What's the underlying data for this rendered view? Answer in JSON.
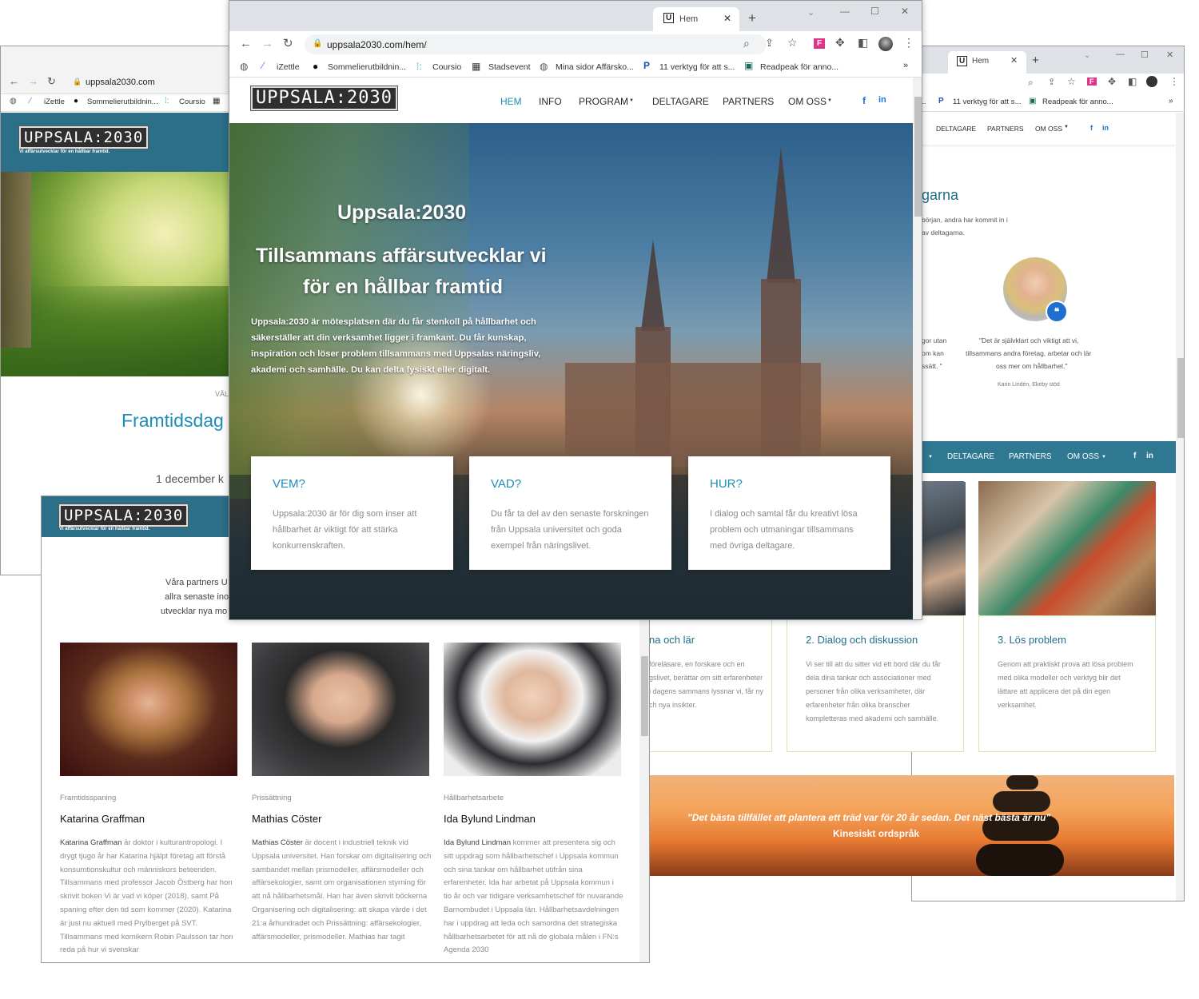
{
  "left_window": {
    "url": "uppsala2030.com",
    "bookmarks": [
      "iZettle",
      "Sommelierutbildnin...",
      "Coursio"
    ],
    "logo": "UPPSALA:2030",
    "tagline": "Vi affärsutvecklar för en hållbar framtid.",
    "eyebrow": "VÄL",
    "heading": "Framtidsdag",
    "date": "1 december k"
  },
  "right_window": {
    "tab_title": "Hem",
    "bookmarks": [
      "11 verktyg för att s...",
      "Readpeak för anno..."
    ],
    "nav": [
      "DELTAGARE",
      "PARTNERS",
      "OM OSS"
    ],
    "section_heading": "garna",
    "intro_lines": [
      "början, andra har kommit in i",
      "av deltagarna."
    ],
    "left_quote_lines": [
      "gor utan",
      "om kan",
      "ssätt. \""
    ],
    "quote": [
      "\"Det är självklart och viktigt att vi,",
      "tillsammans andra företag, arbetar och lär",
      "oss mer om hållbarhet.\""
    ],
    "quote_author": "Karin Lindén, Ekeby stöd",
    "nav2": [
      "DELTAGARE",
      "PARTNERS",
      "OM OSS"
    ],
    "steps": [
      {
        "title": "na och lär",
        "text": "föreläsare, en forskare och en gslivet, berättar om sitt erfarenheter i dagens sammans lyssnar vi, får ny ch nya insikter."
      },
      {
        "title": "2. Dialog och diskussion",
        "text": "Vi ser till att du sitter vid ett bord där du får dela dina tankar och associationer med personer från olika verksamheter, där erfarenheter från olika branscher kompletteras med akademi och samhälle."
      },
      {
        "title": "3. Lös problem",
        "text": "Genom att praktiskt prova att lösa problem med olika modeller och verktyg blir det lättare att applicera det på din egen verksamhet."
      }
    ],
    "banner_quote": "\"Det bästa tillfället att plantera ett träd var för 20 år sedan. Det näst bästa är nu\"",
    "banner_source": "Kinesiskt ordspråk"
  },
  "bottom_window": {
    "logo": "UPPSALA:2030",
    "tagline": "Vi affärsutvecklar för en hållbar framtid.",
    "intro_lines": [
      "Våra partners U",
      "allra senaste ino",
      "utvecklar nya mo"
    ],
    "people": [
      {
        "category": "Framtidsspaning",
        "name": "Katarina Graffman",
        "bio_name": "Katarina Graffman",
        "bio": " är doktor i kulturantropologi. I drygt tjugo år har Katarina hjälpt företag att förstå konsumtionskultur och människors beteenden. Tillsammans med  professor Jacob Östberg har hon skrivit boken Vi är vad vi köper (2018), samt På spaning efter den tid som kommer (2020). Katarina är just nu aktuell med Prylberget på SVT. Tillsammans med komikern Robin Paulsson tar hon reda på hur vi svenskar"
      },
      {
        "category": "Prissättning",
        "name": "Mathias Cöster",
        "bio_name": "Mathias Cöster",
        "bio": " är docent i industriell teknik vid Uppsala universitet. Han forskar om digitalisering och sambandet mellan prismodeller, affärsmodeller och affärsekologier, samt om organisationen styrning för att nå hållbarhetsmål. Han har även skrivit böckerna Organisering och digitalisering: att skapa värde i det 21:a århundradet och Prissättning: affärsekologier, affärsmodeller, prismodeller. Mathias har tagit"
      },
      {
        "category": "Hållbarhetsarbete",
        "name": "Ida Bylund Lindman",
        "bio_name": "Ida Bylund Lindman",
        "bio": " kommer att presentera sig och sitt uppdrag som hållbarhetschef i Uppsala kommun och sina tankar om hållbarhet utifrån sina erfarenheter. Ida har arbetat på Uppsala kommun i tio år och var tidigare verksamhetschef för nuvarande Barnombudet i Uppsala län. Hållbarhetsavdelningen har i uppdrag att leda och samordna det strategiska hållbarhetsarbetet för att nå de globala målen i FN:s Agenda 2030"
      }
    ]
  },
  "main_window": {
    "tab_title": "Hem",
    "url": "uppsala2030.com/hem/",
    "bookmarks": [
      "iZettle",
      "Sommelierutbildnin...",
      "Coursio",
      "Stadsevent",
      "Mina sidor Affärsko...",
      "11 verktyg för att s...",
      "Readpeak för anno..."
    ],
    "more_bookmarks": "»",
    "logo": "UPPSALA:2030",
    "nav": [
      "HEM",
      "INFO",
      "PROGRAM",
      "DELTAGARE",
      "PARTNERS",
      "OM OSS"
    ],
    "hero_kicker": "Uppsala:2030",
    "hero_title_1": "Tillsammans affärsutvecklar vi",
    "hero_title_2": "för en hållbar framtid",
    "hero_text": "Uppsala:2030 är mötesplatsen där du får stenkoll på hållbarhet och säkerställer att din verksamhet ligger i framkant. Du får kunskap, inspiration och löser problem tillsammans med  Uppsalas näringsliv, akademi och samhälle. Du kan delta fysiskt eller digitalt.",
    "cards": [
      {
        "title": "VEM?",
        "text": "Uppsala:2030 är för dig som inser att hållbarhet är viktigt för att stärka konkurrenskraften."
      },
      {
        "title": "VAD?",
        "text": "Du får ta del av den senaste forskningen från Uppsala universitet och goda exempel från näringslivet."
      },
      {
        "title": "HUR?",
        "text": "I dialog och samtal får du kreativt lösa problem och utmaningar tillsammans med övriga deltagare."
      }
    ]
  },
  "colors": {
    "accent": "#1e8db8",
    "nav_bar": "#2e7891",
    "logo_bar": "#2b6f88"
  }
}
